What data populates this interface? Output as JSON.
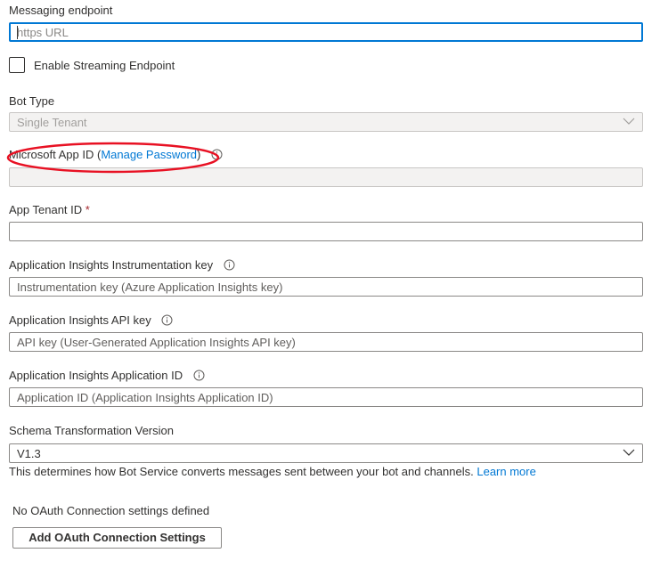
{
  "messaging_endpoint": {
    "label": "Messaging endpoint",
    "placeholder": "https URL"
  },
  "streaming": {
    "label": "Enable Streaming Endpoint",
    "checked": false
  },
  "bot_type": {
    "label": "Bot Type",
    "value": "Single Tenant"
  },
  "app_id": {
    "label": "Microsoft App ID",
    "paren_open": "(",
    "manage_link": "Manage Password",
    "paren_close": ")",
    "value": ""
  },
  "tenant_id": {
    "label": "App Tenant ID",
    "required_mark": "*",
    "value": ""
  },
  "insights_key": {
    "label": "Application Insights Instrumentation key",
    "placeholder": "Instrumentation key (Azure Application Insights key)"
  },
  "insights_api_key": {
    "label": "Application Insights API key",
    "placeholder": "API key (User-Generated Application Insights API key)"
  },
  "insights_app_id": {
    "label": "Application Insights Application ID",
    "placeholder": "Application ID (Application Insights Application ID)"
  },
  "schema": {
    "label": "Schema Transformation Version",
    "value": "V1.3",
    "help": "This determines how Bot Service converts messages sent between your bot and channels.",
    "learn_more": "Learn more"
  },
  "oauth": {
    "empty_text": "No OAuth Connection settings defined",
    "add_button": "Add OAuth Connection Settings"
  },
  "colors": {
    "accent": "#0078d4",
    "annotation": "#e81123",
    "required": "#a4262c"
  },
  "icons": {
    "info": "info-icon",
    "dropdown": "chevron-down-icon"
  }
}
